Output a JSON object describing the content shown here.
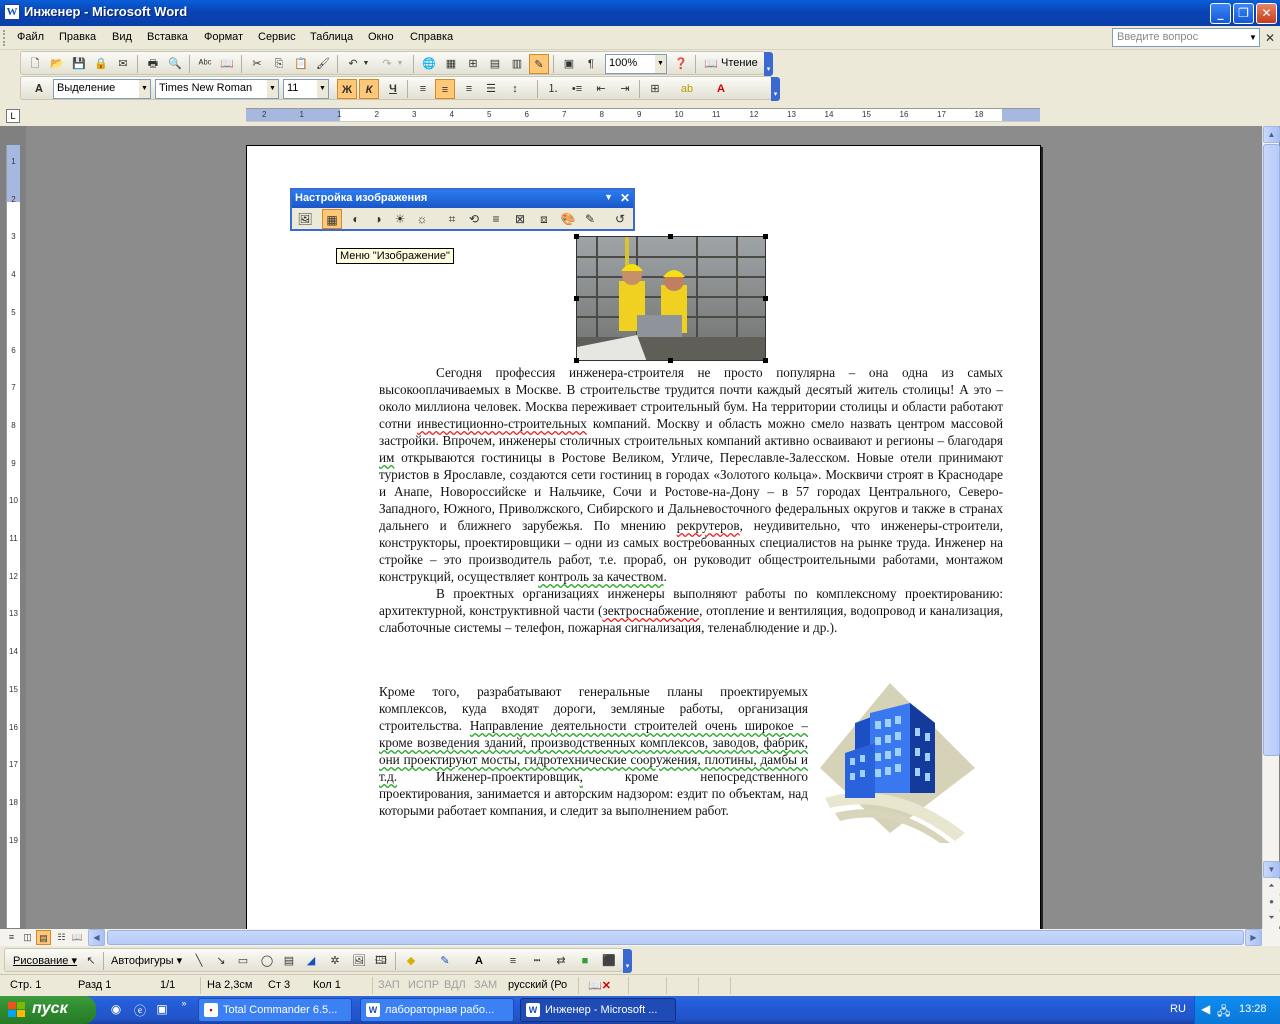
{
  "window": {
    "title": "Инженер - Microsoft Word",
    "min": "_",
    "max": "❐",
    "close": "✕"
  },
  "menu": {
    "items": [
      "Файл",
      "Правка",
      "Вид",
      "Вставка",
      "Формат",
      "Сервис",
      "Таблица",
      "Окно",
      "Справка"
    ],
    "ask_placeholder": "Введите вопрос"
  },
  "standard_toolbar": {
    "zoom": "100%",
    "reading_label": "Чтение"
  },
  "format_toolbar": {
    "style": "Выделение",
    "font": "Times New Roman",
    "size": "11",
    "bold": "Ж",
    "italic": "К",
    "underline": "Ч"
  },
  "ruler": {
    "h_numbers": [
      "2",
      "1",
      "1",
      "2",
      "3",
      "4",
      "5",
      "6",
      "7",
      "8",
      "9",
      "10",
      "11",
      "12",
      "13",
      "14",
      "15",
      "16",
      "17",
      "18"
    ],
    "v_numbers": [
      "1",
      "2",
      "3",
      "4",
      "5",
      "6",
      "7",
      "8",
      "9",
      "10",
      "11",
      "12",
      "13",
      "14",
      "15",
      "16",
      "17",
      "18",
      "19"
    ]
  },
  "picture_toolbar": {
    "title": "Настройка изображения",
    "tooltip": "Меню \"Изображение\""
  },
  "document": {
    "p1": {
      "t1": "Сегодня профессия инженера-строителя не просто популярна – она одна из самых высокооплачиваемых в Москве. В строительстве трудится почти каждый десятый житель столицы! А это – около миллиона человек. Москва переживает строительный бум. На территории столицы и области работают сотни ",
      "w1": "инвестиционно-строительных",
      "t2": " компаний. Москву и область можно смело назвать центром массовой застройки. Впрочем, инженеры столичных строительных компаний активно осваивают и регионы – благодаря ",
      "w2": "им",
      "t3": " открываются гостиницы в Ростове Великом, Угличе, Переславле-Залесском. Новые отели принимают туристов в Ярославле, создаются сети гостиниц в городах «Золотого кольца». Москвичи строят в Краснодаре и Анапе, Новороссийске и Нальчике, Сочи и Ростове-на-Дону – в 57 городах Центрального, Северо-Западного, Южного, Приволжского, Сибирского и Дальневосточного федеральных округов и также в странах дальнего и ближнего зарубежья. По мнению ",
      "w3": "рекрутеров",
      "t4": ", неудивительно, что инженеры-строители, конструкторы, проектировщики – одни из самых востребованных специалистов на рынке труда. Инженер на стройке – это производитель работ, т.е. прораб, он руководит общестроительными работами, монтажом конструкций, осуществляет ",
      "w4": "контроль за качеством",
      "t5": "."
    },
    "p2": {
      "t1": "В проектных организациях инженеры выполняют работы по комплексному проектированию: архитектурной, конструктивной части (",
      "w1": "зектроснабжение",
      "t2": ", отопление и вентиляция, водопровод и канализация, слаботочные системы – телефон, пожарная сигнализация, теленаблюдение и др.)."
    },
    "p2b": {
      "t1": "Кроме того, разрабатывают генеральные планы проектируемых комплексов, куда входят дороги, земляные работы, организация строительства. ",
      "w1": "Направление деятельности строителей очень широкое – кроме возведения зданий, производственных комплексов, заводов, фабрик, они проектируют мосты, гидротехнические сооружения, плотины, дамбы и т.д."
    },
    "p3": {
      "t1": "Инженер-проектировщик",
      "w1": ",",
      "t2": " кроме непосредственного проектирования, занимается и авторским надзором: ездит по объектам, над которыми работает компания, и следит за выполнением работ."
    }
  },
  "drawing_toolbar": {
    "draw": "Рисование ▾",
    "autoshapes": "Автофигуры ▾"
  },
  "status": {
    "page": "Стр. 1",
    "section": "Разд 1",
    "pages": "1/1",
    "at": "На 2,3см",
    "line": "Ст 3",
    "col": "Кол 1",
    "rec": "ЗАП",
    "trk": "ИСПР",
    "ext": "ВДЛ",
    "ovr": "ЗАМ",
    "lang": "русский (Ро"
  },
  "taskbar": {
    "start": "пуск",
    "tasks": [
      "Total Commander 6.5...",
      "лабораторная рабо...",
      "Инженер - Microsoft ..."
    ],
    "lang": "RU",
    "time": "13:28"
  }
}
